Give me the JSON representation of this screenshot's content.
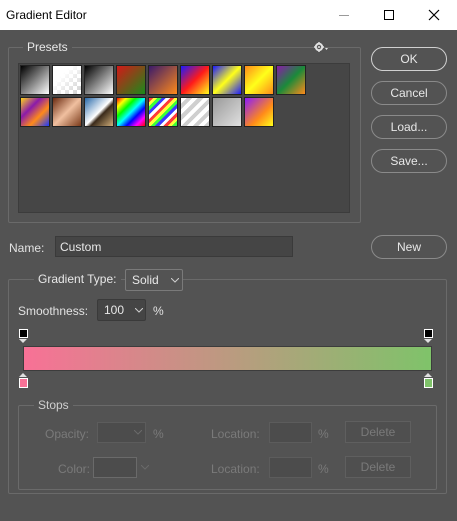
{
  "window": {
    "title": "Gradient Editor"
  },
  "presets": {
    "legend": "Presets",
    "gear_icon": "gear-icon",
    "swatches": [
      {
        "name": "preset-foreground-background",
        "bg": "linear-gradient(135deg,#000 0%,#fff 100%)"
      },
      {
        "name": "preset-foreground-transparent",
        "bg": "linear-gradient(135deg,#fff 0%,#fff 30%,transparent 100%)"
      },
      {
        "name": "preset-black-white",
        "bg": "linear-gradient(135deg,#000 0%,#fff 100%)"
      },
      {
        "name": "preset-red-green",
        "bg": "linear-gradient(135deg,#d41818 0%,#1a8a1a 100%)"
      },
      {
        "name": "preset-violet-orange",
        "bg": "linear-gradient(135deg,#3a1a6a 0%,#ff8a1a 100%)"
      },
      {
        "name": "preset-blue-red-yellow",
        "bg": "linear-gradient(135deg,#1a1aff 0%,#ff1a1a 50%,#ffff1a 100%)"
      },
      {
        "name": "preset-blue-yellow-blue",
        "bg": "linear-gradient(135deg,#1a1aff 0%,#ffff1a 50%,#1a1aff 100%)"
      },
      {
        "name": "preset-orange-yellow-orange",
        "bg": "linear-gradient(135deg,#ff8a1a 0%,#ffff1a 50%,#ff8a1a 100%)"
      },
      {
        "name": "preset-violet-green-orange",
        "bg": "linear-gradient(135deg,#8a1aaa 0%,#1a8a3a 50%,#ff8a1a 100%)"
      },
      {
        "name": "preset-yellow-violet-orange-blue",
        "bg": "linear-gradient(135deg,#ffd41a 0%,#8a1aaa 35%,#ff8a1a 65%,#1a3aff 100%)"
      },
      {
        "name": "preset-copper",
        "bg": "linear-gradient(135deg,#6a2a10 0%,#f0c0a0 50%,#7a3a1a 100%)"
      },
      {
        "name": "preset-chrome",
        "bg": "linear-gradient(135deg,#2a6aaa 0%,#ffffff 50%,#3a2a1a 60%,#cfae7a 100%)"
      },
      {
        "name": "preset-spectrum",
        "bg": "linear-gradient(135deg,#ff0000,#ffff00,#00ff00,#00ffff,#0000ff,#ff00ff,#ff0000)"
      },
      {
        "name": "preset-transparent-rainbow",
        "bg": "repeating-linear-gradient(135deg,#ff3a3a 0 3px,#ffff3a 3px 6px,#3aff3a 6px 9px,#3a3aff 9px 12px,#fff 12px 15px)"
      },
      {
        "name": "preset-transparent-stripes",
        "bg": "repeating-linear-gradient(135deg,#ffffff 0 4px,#cfcfcf 4px 8px)"
      },
      {
        "name": "preset-neutral-density",
        "bg": "linear-gradient(135deg,#9a9a9a 0%,#e0e0e0 100%)"
      },
      {
        "name": "preset-violet-yellow",
        "bg": "linear-gradient(135deg,#8a1aff 0%,#ff8a1a 60%,#ffff1a 100%)"
      }
    ]
  },
  "buttons": {
    "ok": "OK",
    "cancel": "Cancel",
    "load": "Load...",
    "save": "Save...",
    "new": "New"
  },
  "name": {
    "label": "Name:",
    "value": "Custom"
  },
  "gradient_type": {
    "label": "Gradient Type:",
    "value": "Solid"
  },
  "smoothness": {
    "label": "Smoothness:",
    "value": "100",
    "unit": "%"
  },
  "gradient": {
    "start_color": "#f87196",
    "end_color": "#7fc36a",
    "left_stop_color": "#f87196",
    "right_stop_color": "#7fc36a"
  },
  "stops": {
    "legend": "Stops",
    "opacity_label": "Opacity:",
    "opacity_unit": "%",
    "opacity_location_label": "Location:",
    "opacity_location_unit": "%",
    "opacity_delete": "Delete",
    "color_label": "Color:",
    "color_location_label": "Location:",
    "color_location_unit": "%",
    "color_delete": "Delete"
  }
}
